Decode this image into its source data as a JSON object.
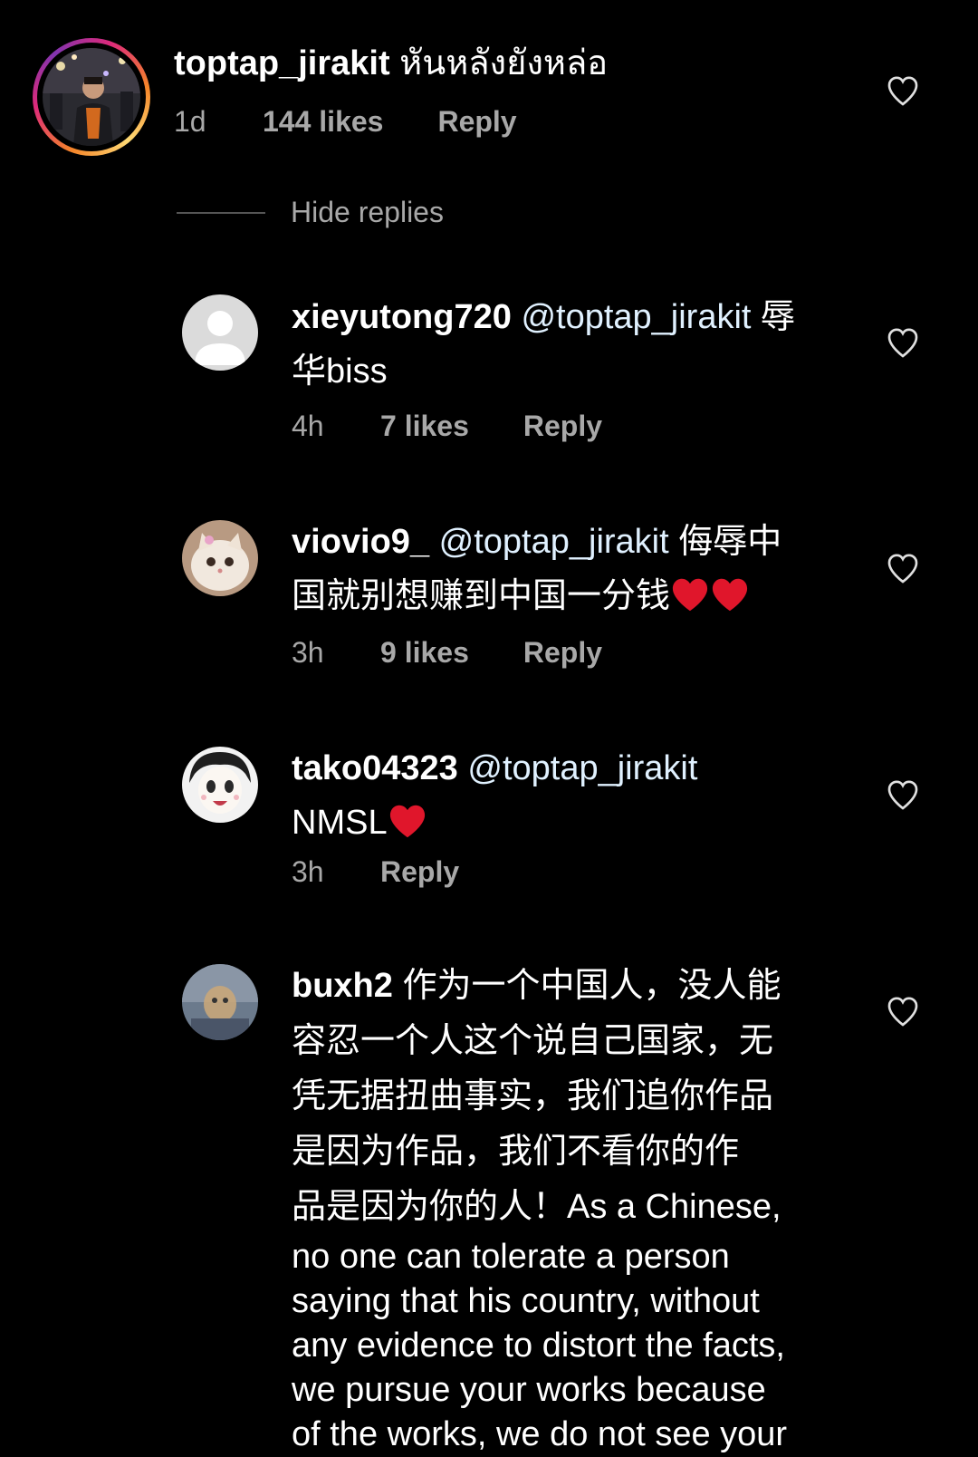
{
  "comments": {
    "main": {
      "username": "toptap_jirakit",
      "text": "หันหลังยังหล่อ",
      "time": "1d",
      "likes": "144 likes",
      "reply": "Reply"
    },
    "hide_replies": "Hide replies",
    "replies": [
      {
        "username": "xieyutong720",
        "mention": "@toptap_jirakit",
        "text_line1_tail": "辱",
        "text_line2": "华biss",
        "time": "4h",
        "likes": "7 likes",
        "reply": "Reply"
      },
      {
        "username": "viovio9_",
        "mention": "@toptap_jirakit",
        "text_line1_tail": "侮辱中",
        "text_line2": "国就别想赚到中国一分钱",
        "time": "3h",
        "likes": "9 likes",
        "reply": "Reply"
      },
      {
        "username": "tako04323",
        "mention": "@toptap_jirakit",
        "text_line2": "NMSL",
        "time": "3h",
        "reply": "Reply"
      },
      {
        "username": "buxh2",
        "lines": [
          "作为一个中国人，没人能",
          "容忍一个人这个说自己国家，无",
          "凭无据扭曲事实，我们追你作品",
          "是因为作品，我们不看你的作",
          "品是因为你的人！As a Chinese,",
          "no one can tolerate a person",
          "saying that his country, without",
          "any evidence to distort the facts,",
          "we pursue your works because",
          "of the works, we do not see your"
        ]
      }
    ]
  },
  "colors": {
    "background": "#000000",
    "meta_text": "#a8a8a8",
    "mention": "#e0f1ff",
    "emoji_heart": "#e0162b"
  },
  "icons": {
    "like": "heart-outline-icon",
    "emoji": "red-heart-emoji"
  }
}
